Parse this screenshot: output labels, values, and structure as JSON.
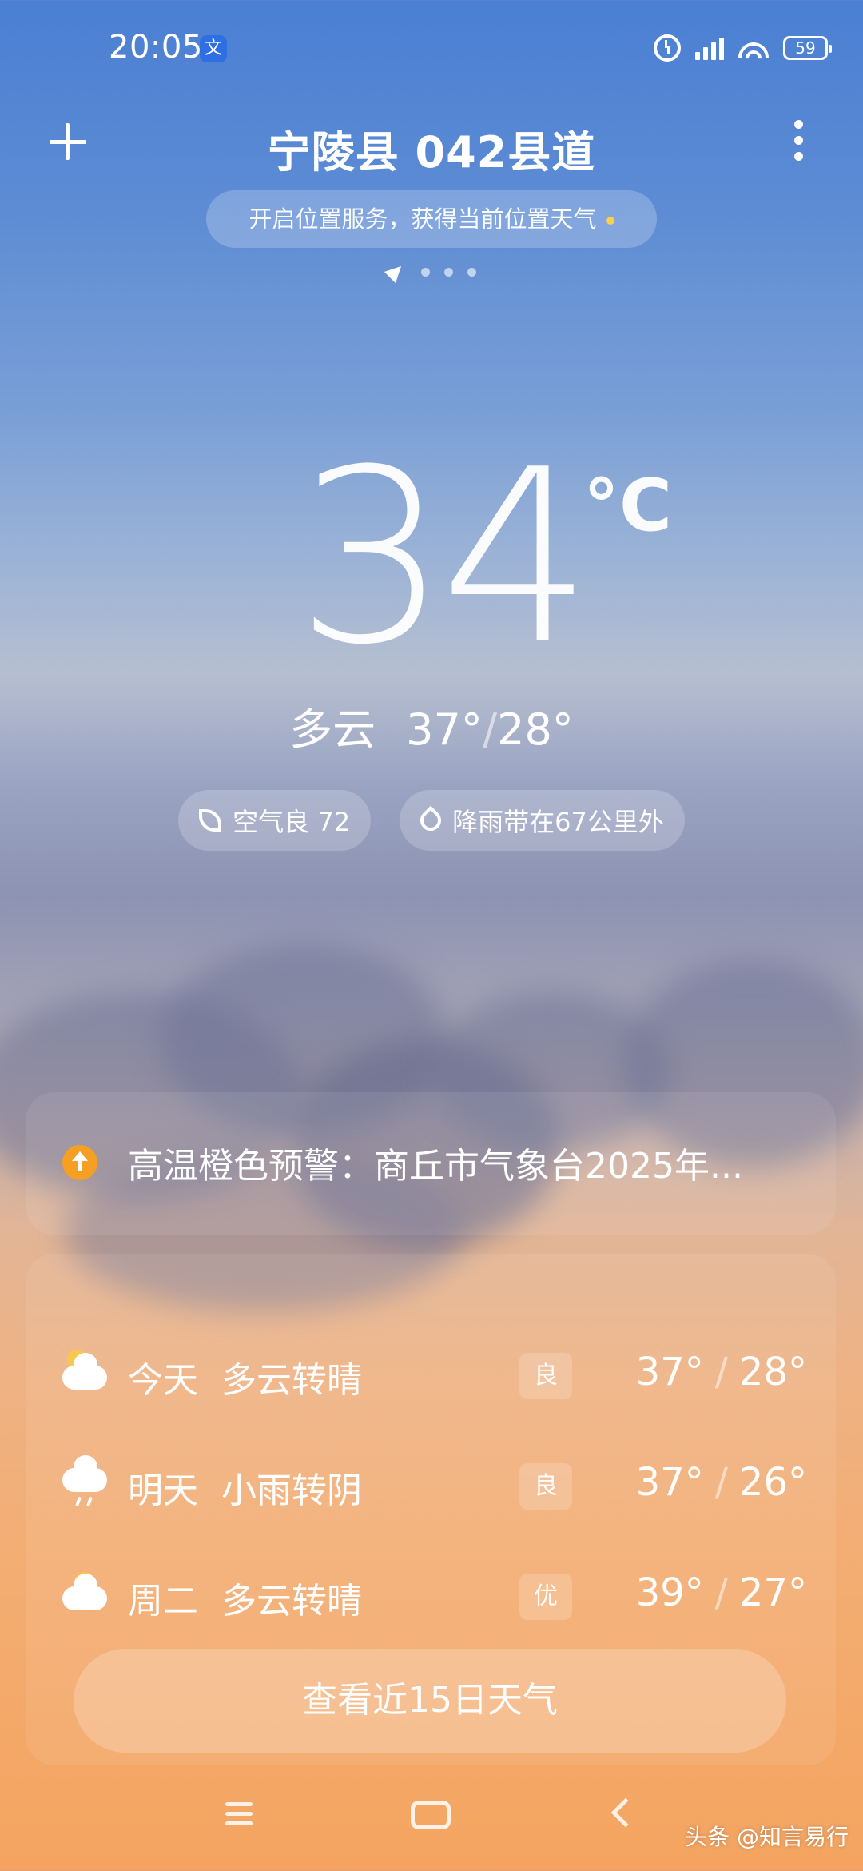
{
  "status_bar": {
    "time": "20:05",
    "notification_badge": "文",
    "battery": "59"
  },
  "header": {
    "location": "宁陵县 042县道",
    "location_service_prompt": "开启位置服务，获得当前位置天气"
  },
  "current": {
    "temperature": "34",
    "unit": "°C",
    "condition": "多云",
    "high": "37°",
    "low": "28°",
    "air_quality": "空气良 72",
    "rain_info": "降雨带在67公里外"
  },
  "warning": {
    "text": "高温橙色预警：商丘市气象台2025年..."
  },
  "forecast": [
    {
      "day": "今天",
      "condition": "多云转晴",
      "aqi": "良",
      "high": "37°",
      "low": "28°",
      "icon": "partly-cloudy-night-icon"
    },
    {
      "day": "明天",
      "condition": "小雨转阴",
      "aqi": "良",
      "high": "37°",
      "low": "26°",
      "icon": "light-rain-icon"
    },
    {
      "day": "周二",
      "condition": "多云转晴",
      "aqi": "优",
      "high": "39°",
      "low": "27°",
      "icon": "partly-cloudy-icon"
    }
  ],
  "buttons": {
    "fifteen_day": "查看近15日天气"
  },
  "watermark": "头条 @知言易行",
  "separator": "/"
}
